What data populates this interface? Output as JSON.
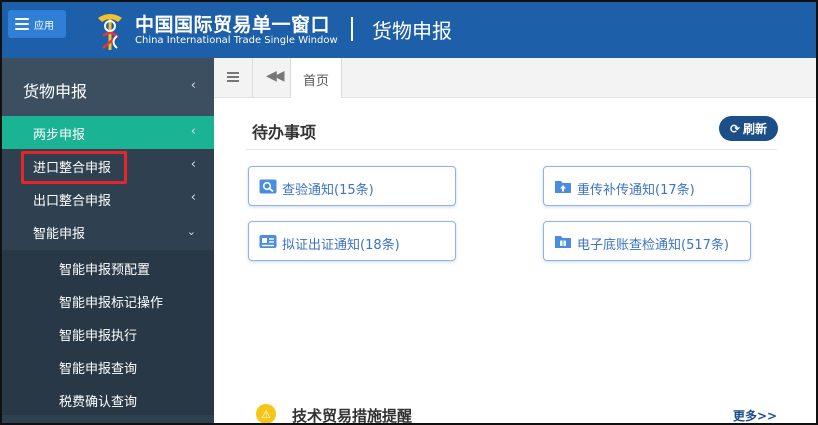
{
  "header": {
    "app_button_label": "应用",
    "brand_cn": "中国国际贸易单一窗口",
    "brand_en": "China International Trade Single Window",
    "title": "货物申报"
  },
  "sidebar": {
    "title": "货物申报",
    "items": [
      {
        "label": "两步申报",
        "active": true
      },
      {
        "label": "进口整合申报",
        "highlighted": true
      },
      {
        "label": "出口整合申报"
      },
      {
        "label": "智能申报",
        "expanded": true
      }
    ],
    "subitems": [
      {
        "label": "智能申报预配置"
      },
      {
        "label": "智能申报标记操作"
      },
      {
        "label": "智能申报执行"
      },
      {
        "label": "智能申报查询"
      },
      {
        "label": "税费确认查询"
      }
    ]
  },
  "tabs": {
    "home_label": "首页"
  },
  "todo": {
    "title": "待办事项",
    "refresh_label": "刷新",
    "cards": [
      {
        "label": "查验通知(15条)",
        "icon": "inspection-icon"
      },
      {
        "label": "重传补传通知(17条)",
        "icon": "upload-icon"
      },
      {
        "label": "拟证出证通知(18条)",
        "icon": "certificate-icon"
      },
      {
        "label": "电子底账查检通知(517条)",
        "icon": "ledger-icon"
      }
    ]
  },
  "tech": {
    "title": "技术贸易措施提醒",
    "more_label": "更多>>"
  },
  "colors": {
    "header_bg": "#1d5fa8",
    "sidebar_bg": "#2f4050",
    "active_bg": "#1ab394",
    "highlight_border": "#e8262a",
    "card_text": "#3c73c4",
    "button_bg": "#1c4f8a"
  }
}
